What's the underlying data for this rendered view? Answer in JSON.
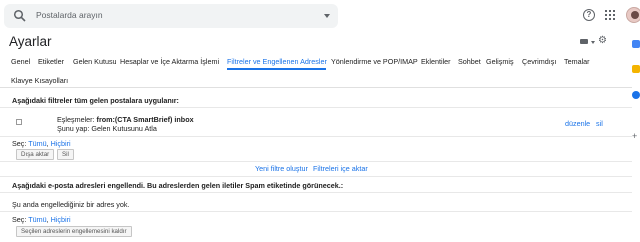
{
  "search": {
    "placeholder": "Postalarda arayın"
  },
  "header": {
    "title": "Ayarlar"
  },
  "tabs": [
    {
      "label": "Genel"
    },
    {
      "label": "Etiketler"
    },
    {
      "label": "Gelen Kutusu"
    },
    {
      "label": "Hesaplar ve İçe Aktarma İşlemi"
    },
    {
      "label": "Filtreler ve Engellenen Adresler",
      "active": true
    },
    {
      "label": "Yönlendirme ve POP/IMAP"
    },
    {
      "label": "Eklentiler"
    },
    {
      "label": "Sohbet"
    },
    {
      "label": "Gelişmiş"
    },
    {
      "label": "Çevrimdışı"
    },
    {
      "label": "Temalar"
    },
    {
      "label": "Klavye Kısayolları"
    }
  ],
  "filters": {
    "heading": "Aşağıdaki filtreler tüm gelen postalara uygulanır:",
    "item": {
      "match_prefix": "Eşleşmeler:",
      "match_value": "from:(CTA SmartBrief) inbox",
      "action": "Şunu yap: Gelen Kutusunu Atla",
      "edit": "düzenle",
      "delete": "sil"
    },
    "select_prefix": "Seç:",
    "select_all": "Tümü",
    "select_none": "Hiçbiri",
    "export_button": "Dışa aktar",
    "delete_button": "Sil",
    "create_link": "Yeni filtre oluştur",
    "import_link": "Filtreleri içe aktar"
  },
  "blocked": {
    "heading": "Aşağıdaki e-posta adresleri engellendi. Bu adreslerden gelen iletiler Spam etiketinde görünecek.:",
    "empty": "Şu anda engellediğiniz bir adres yok.",
    "select_prefix": "Seç:",
    "select_all": "Tümü",
    "select_none": "Hiçbiri",
    "unblock_button": "Seçilen adreslerin engellemesini kaldır"
  },
  "colors": {
    "accent": "#1a73e8",
    "rail_yellow": "#f4b400",
    "rail_blue": "#1a73e8",
    "rail_calendar": "#4285f4"
  },
  "icons": [
    "search-icon",
    "dropdown-caret-icon",
    "help-icon",
    "apps-grid-icon",
    "avatar",
    "keyboard-icon",
    "gear-icon",
    "calendar-icon",
    "keep-icon",
    "tasks-icon",
    "plus-icon"
  ]
}
